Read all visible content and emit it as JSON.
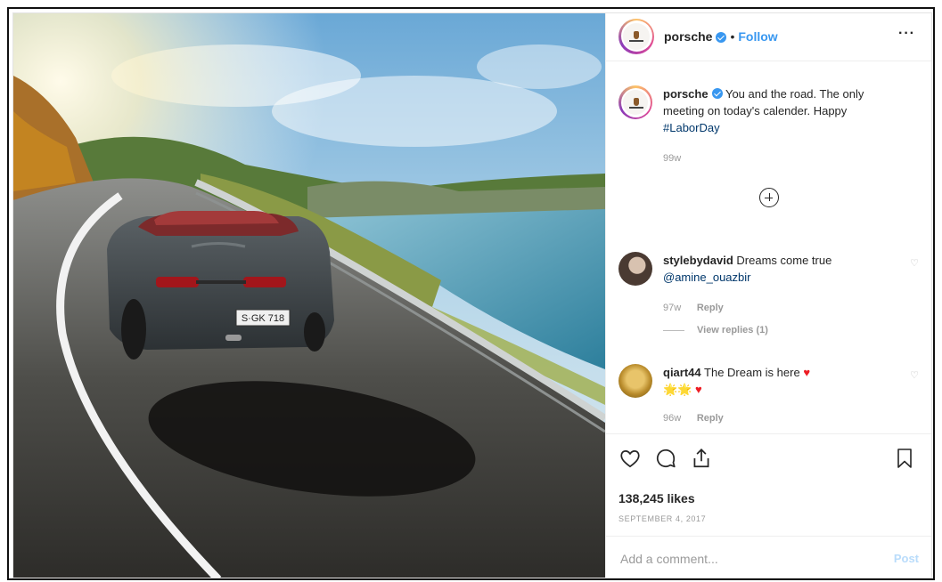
{
  "header": {
    "username": "porsche",
    "separator": "•",
    "follow_label": "Follow",
    "more_label": "···"
  },
  "caption": {
    "username": "porsche",
    "text": "You and the road. The only meeting on today's calender. Happy ",
    "hashtag": "#LaborDay",
    "time": "99w"
  },
  "comments": [
    {
      "username": "stylebydavid",
      "text": "Dreams come true",
      "mention": "@amine_ouazbir",
      "time": "97w",
      "reply_label": "Reply",
      "view_replies": "View replies (1)"
    },
    {
      "username": "qiart44",
      "text": "The Dream is here",
      "emoji_line": "🌟🌟",
      "time": "96w",
      "reply_label": "Reply"
    }
  ],
  "likes": "138,245 likes",
  "date": "SEPTEMBER 4, 2017",
  "add_comment": {
    "placeholder": "Add a comment...",
    "post_label": "Post"
  },
  "photo": {
    "license_plate": "S·GK 718"
  },
  "colors": {
    "link": "#3897f0",
    "hashtag": "#00376b",
    "muted": "#9a9a9a",
    "heart": "#ed1c24"
  },
  "icons": [
    "heart-icon",
    "comment-icon",
    "share-icon",
    "bookmark-icon",
    "plus-circle-icon",
    "verified-badge-icon"
  ]
}
